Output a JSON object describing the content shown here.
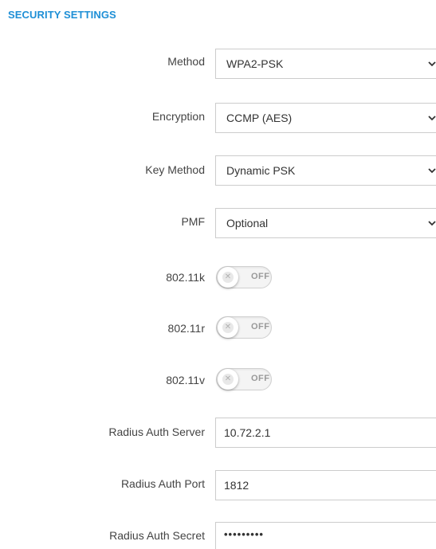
{
  "section": {
    "title": "SECURITY SETTINGS"
  },
  "method": {
    "label": "Method",
    "value": "WPA2-PSK",
    "icon": "chevron-down-icon"
  },
  "encryption": {
    "label": "Encryption",
    "value": "CCMP (AES)",
    "icon": "chevron-down-icon"
  },
  "key_method": {
    "label": "Key Method",
    "value": "Dynamic PSK",
    "icon": "chevron-down-icon"
  },
  "pmf": {
    "label": "PMF",
    "value": "Optional",
    "icon": "chevron-down-icon"
  },
  "k802_11k": {
    "label": "802.11k",
    "state": "OFF",
    "knob_icon": "x-icon"
  },
  "k802_11r": {
    "label": "802.11r",
    "state": "OFF",
    "knob_icon": "x-icon"
  },
  "k802_11v": {
    "label": "802.11v",
    "state": "OFF",
    "knob_icon": "x-icon"
  },
  "radius_server": {
    "label": "Radius Auth Server",
    "value": "10.72.2.1"
  },
  "radius_port": {
    "label": "Radius Auth Port",
    "value": "1812"
  },
  "radius_secret": {
    "label": "Radius Auth Secret",
    "value": "•••••••••"
  },
  "colors": {
    "accent": "#1e8fd6",
    "border": "#cccccc",
    "label_text": "#444444"
  }
}
